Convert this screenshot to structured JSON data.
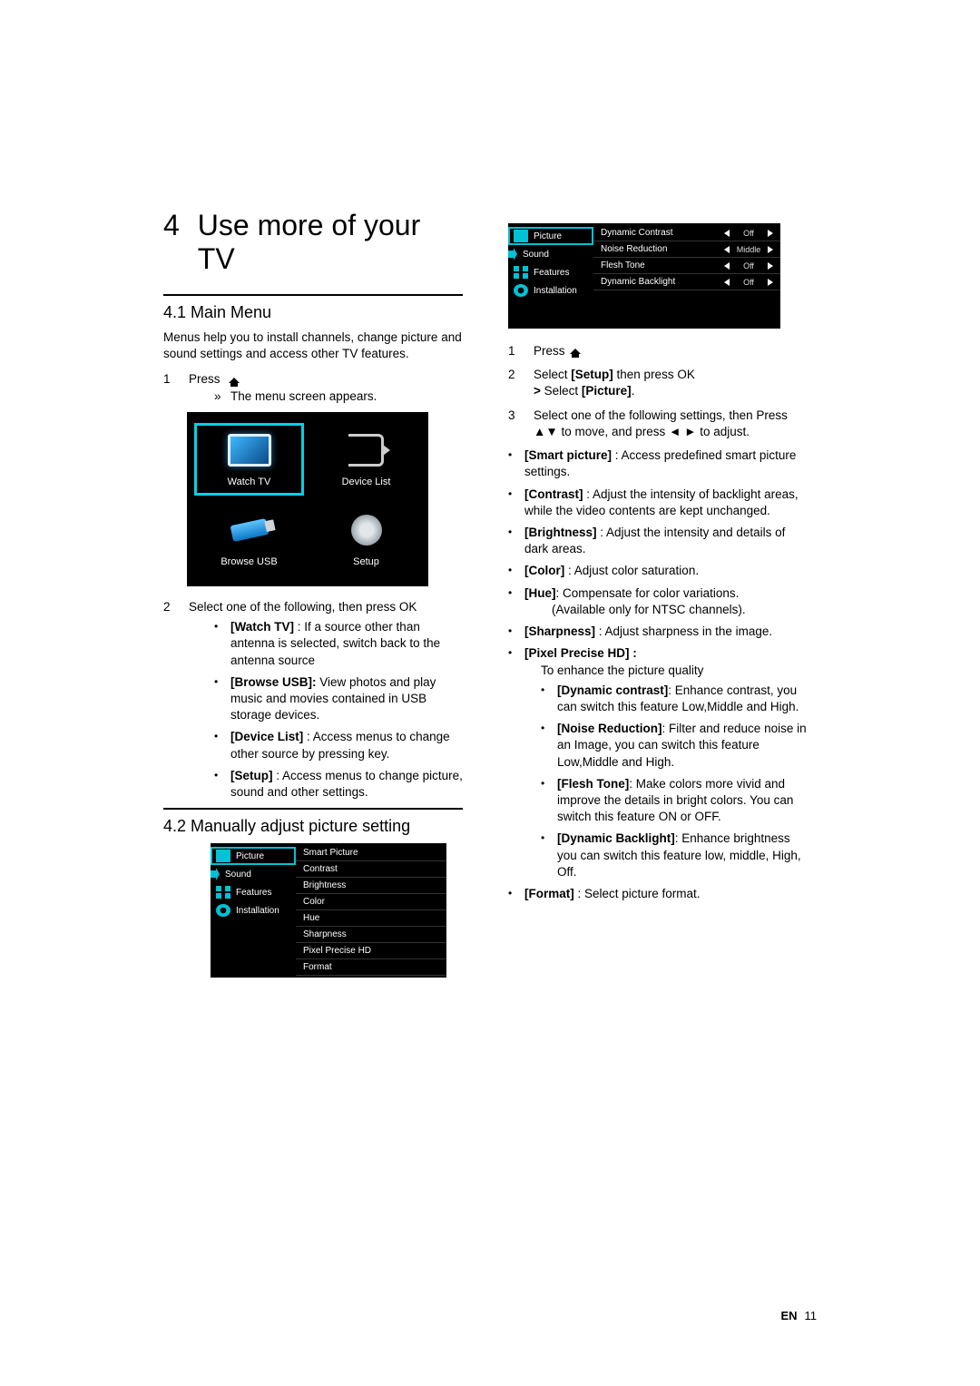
{
  "chapter": {
    "number": "4",
    "title": "Use more of your TV"
  },
  "section41": {
    "heading": "4.1 Main Menu",
    "intro": "Menus help you to install channels, change picture and sound settings and access other TV features.",
    "step1_prefix": "Press",
    "step1_result": "The menu screen appears.",
    "tiles": {
      "watch": "Watch TV",
      "device": "Device List",
      "usb": "Browse USB",
      "setup": "Setup"
    },
    "step2_text": "Select one of the following, then press OK",
    "opt_watch_label": "[Watch TV]",
    "opt_watch_desc": " : If a source other than antenna is selected, switch back to the antenna source",
    "opt_usb_label": "[Browse USB]:",
    "opt_usb_desc": " View photos and play music and movies contained in USB storage devices.",
    "opt_dev_label": "[Device List]",
    "opt_dev_desc": " : Access menus to change other source by pressing key.",
    "opt_setup_label": "[Setup]",
    "opt_setup_desc": " : Access menus to change picture, sound and other settings."
  },
  "section42": {
    "heading": "4.2 Manually adjust picture setting",
    "sidebar": {
      "picture": "Picture",
      "sound": "Sound",
      "features": "Features",
      "installation": "Installation"
    },
    "picture_list": [
      "Smart Picture",
      "Contrast",
      "Brightness",
      "Color",
      "Hue",
      "Sharpness",
      "Pixel Precise HD",
      "Format"
    ]
  },
  "right": {
    "osd_rows": [
      {
        "label": "Dynamic Contrast",
        "value": "Off"
      },
      {
        "label": "Noise Reduction",
        "value": "Middle"
      },
      {
        "label": "Flesh Tone",
        "value": "Off"
      },
      {
        "label": "Dynamic Backlight",
        "value": "Off"
      }
    ],
    "step1_prefix": "Press",
    "step2_a": "Select ",
    "step2_setup": "[Setup]",
    "step2_b": " then press OK",
    "step2_c": "> ",
    "step2_d": "Select ",
    "step2_picture": "[Picture]",
    "step2_e": ".",
    "step3": "Select one of the following settings, then Press ▲▼ to move, and press ◄ ► to adjust.",
    "smart_label": "[Smart picture]",
    "smart_desc": " : Access predefined smart picture settings.",
    "contrast_label": "[Contrast]",
    "contrast_desc": " : Adjust the intensity of backlight areas, while the video contents are kept unchanged.",
    "brightness_label": "[Brightness]",
    "brightness_desc": " : Adjust the intensity and details of dark areas.",
    "color_label": "[Color]",
    "color_desc": " : Adjust color saturation.",
    "hue_label": "[Hue]",
    "hue_desc": ": Compensate for color variations.",
    "hue_note": "(Available only for NTSC channels).",
    "sharp_label": "[Sharpness]",
    "sharp_desc": " : Adjust sharpness in the image.",
    "pphd_label": "[Pixel Precise HD] :",
    "pphd_desc": "To enhance the picture quality",
    "dc_label": "[Dynamic contrast]",
    "dc_desc": ": Enhance contrast, you can switch this feature Low,Middle and High.",
    "nr_label": "[Noise Reduction]",
    "nr_desc": ": Filter and reduce noise in an Image, you can switch this feature Low,Middle and High.",
    "ft_label": "[Flesh Tone]",
    "ft_desc": ": Make colors more vivid and improve the details in bright colors. You can switch this feature ON or OFF.",
    "db_label": "[Dynamic Backlight]",
    "db_desc": ": Enhance brightness you can switch this feature low, middle, High, Off.",
    "format_label": "[Format]",
    "format_desc": " : Select picture format."
  },
  "footer": {
    "lang": "EN",
    "page": "11"
  }
}
